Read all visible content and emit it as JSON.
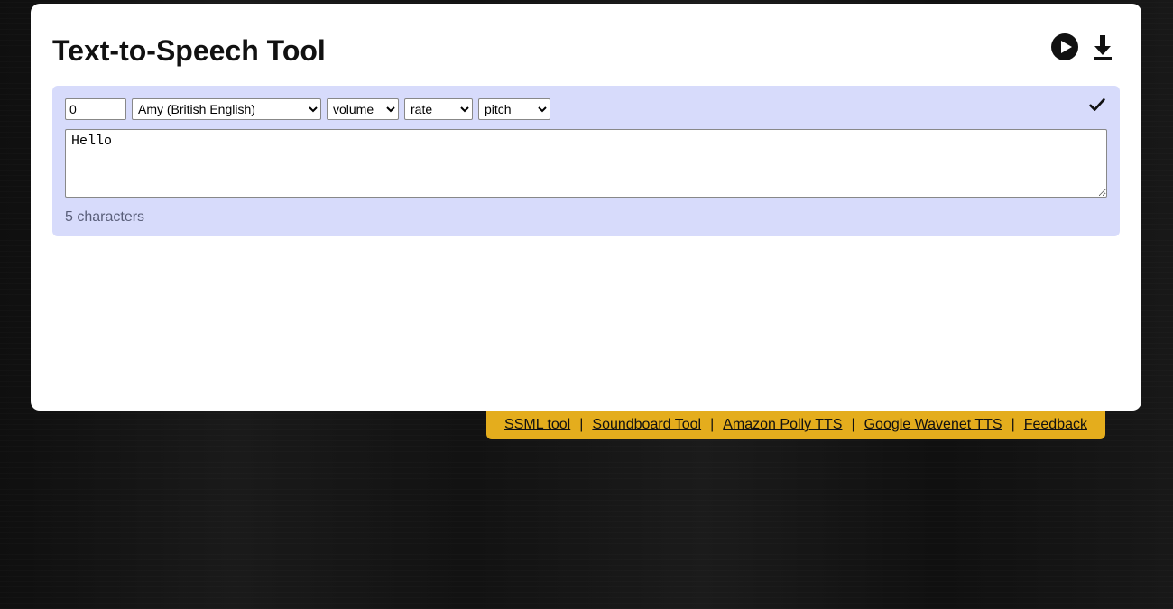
{
  "header": {
    "title": "Text-to-Speech Tool"
  },
  "panel": {
    "number_value": "0",
    "voice_selected": "Amy (British English)",
    "volume_selected": "volume",
    "rate_selected": "rate",
    "pitch_selected": "pitch",
    "text_value": "Hello",
    "char_count": "5 characters"
  },
  "footer": {
    "links": [
      "SSML tool",
      "Soundboard Tool",
      "Amazon Polly TTS",
      "Google Wavenet TTS",
      "Feedback"
    ],
    "separator": "|"
  }
}
